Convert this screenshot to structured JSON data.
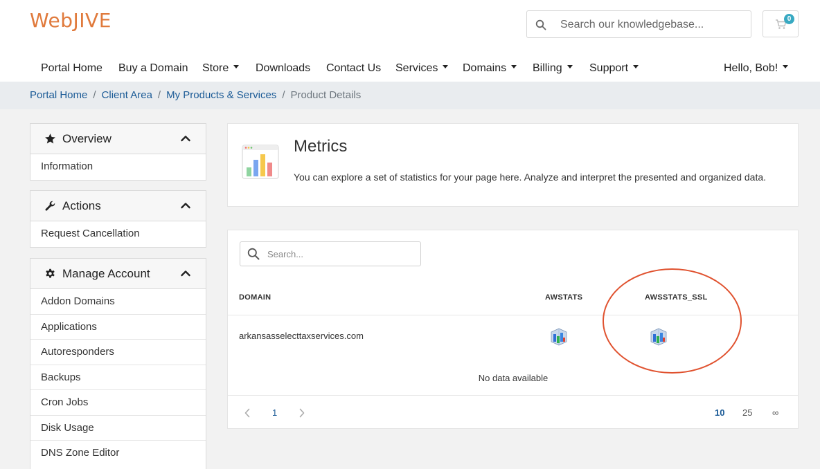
{
  "header": {
    "logo": "WebJIVE",
    "search_placeholder": "Search our knowledgebase...",
    "cart_count": "0"
  },
  "nav": {
    "items": [
      {
        "label": "Portal Home",
        "dropdown": false
      },
      {
        "label": "Buy a Domain",
        "dropdown": false
      },
      {
        "label": "Store",
        "dropdown": true
      },
      {
        "label": "Downloads",
        "dropdown": false
      },
      {
        "label": "Contact Us",
        "dropdown": false
      },
      {
        "label": "Services",
        "dropdown": true
      },
      {
        "label": "Domains",
        "dropdown": true
      },
      {
        "label": "Billing",
        "dropdown": true
      },
      {
        "label": "Support",
        "dropdown": true
      }
    ],
    "user": "Hello, Bob!"
  },
  "breadcrumb": {
    "links": [
      "Portal Home",
      "Client Area",
      "My Products & Services"
    ],
    "current": "Product Details"
  },
  "sidebar": {
    "overview": {
      "title": "Overview",
      "icon": "star-icon",
      "items": [
        "Information"
      ]
    },
    "actions": {
      "title": "Actions",
      "icon": "wrench-icon",
      "items": [
        "Request Cancellation"
      ]
    },
    "manage": {
      "title": "Manage Account",
      "icon": "gear-icon",
      "items": [
        "Addon Domains",
        "Applications",
        "Autoresponders",
        "Backups",
        "Cron Jobs",
        "Disk Usage",
        "DNS Zone Editor"
      ]
    }
  },
  "metrics": {
    "title": "Metrics",
    "description": "You can explore a set of statistics for your page here. Analyze and interpret the presented and organized data."
  },
  "table": {
    "search_placeholder": "Search...",
    "columns": [
      "DOMAIN",
      "AWSTATS",
      "AWSSTATS_SSL"
    ],
    "rows": [
      {
        "domain": "arkansasselecttaxservices.com",
        "awstats": "awstats-chart-icon",
        "awstats_ssl": "awstats-chart-icon"
      }
    ],
    "empty_text": "No data available",
    "pagination": {
      "current_page": "1"
    },
    "page_sizes": [
      "10",
      "25",
      "∞"
    ],
    "selected_page_size": "10"
  },
  "colors": {
    "brand_orange": "#e07a3c",
    "link_blue": "#1a5a96",
    "badge": "#38a9c2",
    "annotation_red": "#e0522f"
  }
}
